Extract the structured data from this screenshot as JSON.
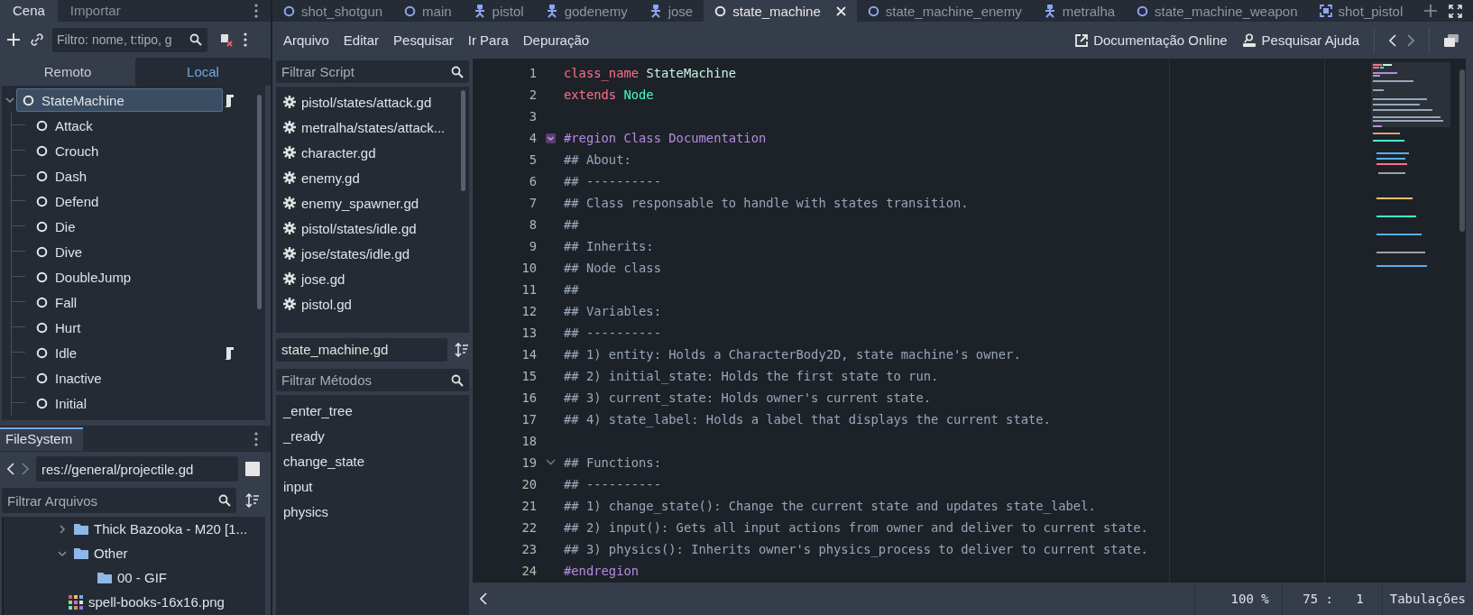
{
  "scene_dock": {
    "tabs": [
      {
        "label": "Cena",
        "selected": true
      },
      {
        "label": "Importar",
        "selected": false
      }
    ],
    "filter": {
      "placeholder": "Filtro: nome, t:tipo, g"
    },
    "mode_tabs": [
      {
        "label": "Remoto",
        "selected": false
      },
      {
        "label": "Local",
        "selected": true
      }
    ],
    "tree": [
      {
        "label": "StateMachine",
        "selected": true,
        "expanded": true,
        "script": true,
        "children": [
          {
            "label": "Attack",
            "selected": false,
            "script": false
          },
          {
            "label": "Crouch",
            "selected": false,
            "script": false
          },
          {
            "label": "Dash",
            "selected": false,
            "script": false
          },
          {
            "label": "Defend",
            "selected": false,
            "script": false
          },
          {
            "label": "Die",
            "selected": false,
            "script": false
          },
          {
            "label": "Dive",
            "selected": false,
            "script": false
          },
          {
            "label": "DoubleJump",
            "selected": false,
            "script": false
          },
          {
            "label": "Fall",
            "selected": false,
            "script": false
          },
          {
            "label": "Hurt",
            "selected": false,
            "script": false
          },
          {
            "label": "Idle",
            "selected": false,
            "script": true
          },
          {
            "label": "Inactive",
            "selected": false,
            "script": false
          },
          {
            "label": "Initial",
            "selected": false,
            "script": false
          }
        ]
      }
    ]
  },
  "filesystem": {
    "tab": "FileSystem",
    "path": "res://general/projectile.gd",
    "filter": {
      "placeholder": "Filtrar Arquivos"
    },
    "tree": [
      {
        "label": "Thick Bazooka - M20 [1...",
        "kind": "folder",
        "expanded": false
      },
      {
        "label": "Other",
        "kind": "folder",
        "expanded": true,
        "children": [
          {
            "label": "00 - GIF",
            "kind": "folder"
          }
        ]
      },
      {
        "label": "spell-books-16x16.png",
        "kind": "image"
      }
    ]
  },
  "editor_tabs": [
    {
      "label": "shot_shotgun",
      "kind": "node",
      "selected": false
    },
    {
      "label": "main",
      "kind": "node",
      "selected": false
    },
    {
      "label": "pistol",
      "kind": "character",
      "selected": false
    },
    {
      "label": "godenemy",
      "kind": "character",
      "selected": false
    },
    {
      "label": "jose",
      "kind": "character",
      "selected": false
    },
    {
      "label": "state_machine",
      "kind": "node",
      "selected": true
    },
    {
      "label": "state_machine_enemy",
      "kind": "node",
      "selected": false
    },
    {
      "label": "metralha",
      "kind": "character",
      "selected": false
    },
    {
      "label": "state_machine_weapon",
      "kind": "node",
      "selected": false
    },
    {
      "label": "shot_pistol",
      "kind": "frame",
      "selected": false
    }
  ],
  "menu": [
    "Arquivo",
    "Editar",
    "Pesquisar",
    "Ir Para",
    "Depuração"
  ],
  "help_links": [
    {
      "label": "Documentação Online",
      "kind": "online"
    },
    {
      "label": "Pesquisar Ajuda",
      "kind": "search"
    }
  ],
  "script_panel": {
    "filter": {
      "placeholder": "Filtrar Script"
    },
    "scripts": [
      "pistol/states/attack.gd",
      "metralha/states/attack...",
      "character.gd",
      "enemy.gd",
      "enemy_spawner.gd",
      "pistol/states/idle.gd",
      "jose/states/idle.gd",
      "jose.gd",
      "pistol.gd"
    ],
    "current": "state_machine.gd",
    "method_filter": {
      "placeholder": "Filtrar Métodos"
    },
    "methods": [
      "_enter_tree",
      "_ready",
      "change_state",
      "input",
      "physics"
    ]
  },
  "code": [
    {
      "number": "1",
      "tokens": [
        {
          "kind": "keyword",
          "text": "class_name "
        },
        {
          "kind": "classname",
          "text": "StateMachine"
        }
      ]
    },
    {
      "number": "2",
      "tokens": [
        {
          "kind": "keyword",
          "text": "extends "
        },
        {
          "kind": "type",
          "text": "Node"
        }
      ]
    },
    {
      "number": "3"
    },
    {
      "number": "4",
      "kind": "region-fold",
      "tokens": [
        {
          "kind": "region",
          "text": "#region Class Documentation"
        }
      ]
    },
    {
      "number": "5",
      "tokens": [
        {
          "kind": "doc",
          "text": "## About:"
        }
      ]
    },
    {
      "number": "6",
      "tokens": [
        {
          "kind": "doc",
          "text": "## ----------"
        }
      ]
    },
    {
      "number": "7",
      "tokens": [
        {
          "kind": "doc",
          "text": "## Class responsable to handle with states transition."
        }
      ]
    },
    {
      "number": "8",
      "tokens": [
        {
          "kind": "doc",
          "text": "##"
        }
      ]
    },
    {
      "number": "9",
      "tokens": [
        {
          "kind": "doc",
          "text": "## Inherits:"
        }
      ]
    },
    {
      "number": "10",
      "tokens": [
        {
          "kind": "doc",
          "text": "## Node class"
        }
      ]
    },
    {
      "number": "11",
      "tokens": [
        {
          "kind": "doc",
          "text": "##"
        }
      ]
    },
    {
      "number": "12",
      "tokens": [
        {
          "kind": "doc",
          "text": "## Variables:"
        }
      ]
    },
    {
      "number": "13",
      "tokens": [
        {
          "kind": "doc",
          "text": "## ----------"
        }
      ]
    },
    {
      "number": "14",
      "tokens": [
        {
          "kind": "doc",
          "text": "## 1) entity: Holds a CharacterBody2D, state machine's owner."
        }
      ]
    },
    {
      "number": "15",
      "tokens": [
        {
          "kind": "doc",
          "text": "## 2) initial_state: Holds the first state to run."
        }
      ]
    },
    {
      "number": "16",
      "tokens": [
        {
          "kind": "doc",
          "text": "## 3) current_state: Holds owner's current state."
        }
      ]
    },
    {
      "number": "17",
      "tokens": [
        {
          "kind": "doc",
          "text": "## 4) state_label: Holds a label that displays the current state."
        }
      ]
    },
    {
      "number": "18"
    },
    {
      "number": "19",
      "kind": "arrow-fold",
      "tokens": [
        {
          "kind": "doc",
          "text": "## Functions:"
        }
      ]
    },
    {
      "number": "20",
      "tokens": [
        {
          "kind": "doc",
          "text": "## ----------"
        }
      ]
    },
    {
      "number": "21",
      "tokens": [
        {
          "kind": "doc",
          "text": "## 1) change_state(): Change the current state and updates state_label."
        }
      ]
    },
    {
      "number": "22",
      "tokens": [
        {
          "kind": "doc",
          "text": "## 2) input(): Gets all input actions from owner and deliver to current state."
        }
      ]
    },
    {
      "number": "23",
      "tokens": [
        {
          "kind": "doc",
          "text": "## 3) physics(): Inherits owner's physics_process to deliver to current state."
        }
      ]
    },
    {
      "number": "24",
      "tokens": [
        {
          "kind": "region",
          "text": "#endregion"
        }
      ]
    }
  ],
  "status_bar": {
    "zoom": "100 %",
    "cursor": "75 :   1",
    "indent": "Tabulações"
  }
}
